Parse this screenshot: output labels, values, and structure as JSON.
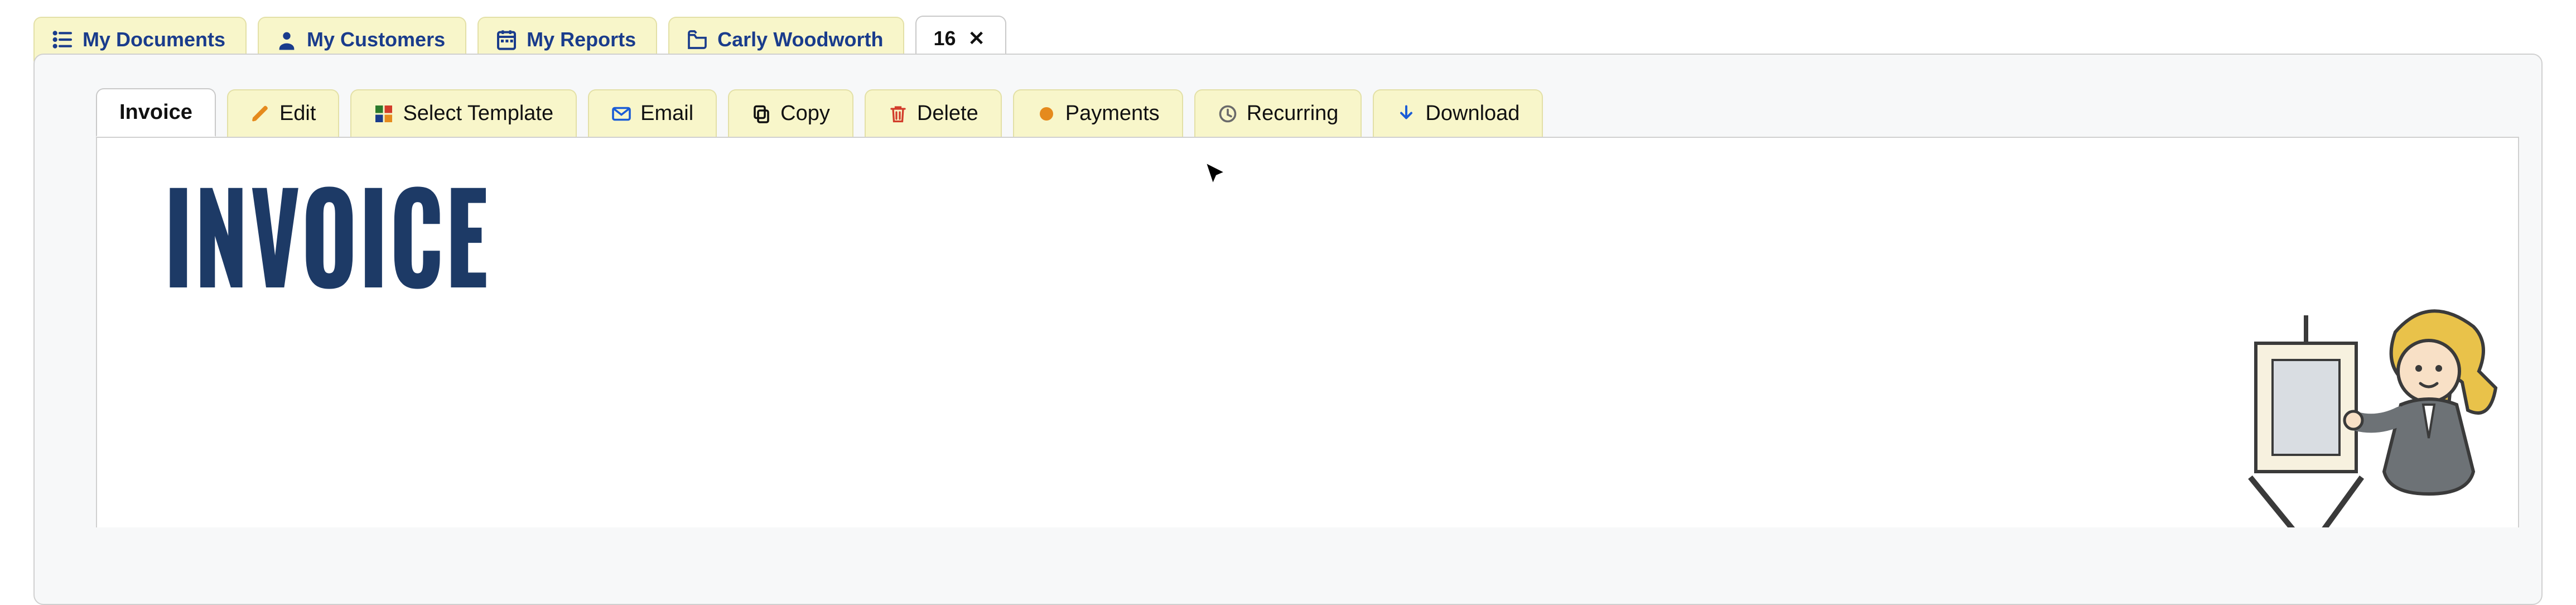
{
  "top_tabs": [
    {
      "label": "My Documents",
      "icon": "list"
    },
    {
      "label": "My Customers",
      "icon": "user"
    },
    {
      "label": "My Reports",
      "icon": "calendar"
    },
    {
      "label": "Carly Woodworth",
      "icon": "folder"
    },
    {
      "label": "16",
      "icon": "",
      "active": true,
      "closable": true
    }
  ],
  "sub_tabs": [
    {
      "label": "Invoice",
      "icon": "",
      "active": true
    },
    {
      "label": "Edit",
      "icon": "pencil"
    },
    {
      "label": "Select Template",
      "icon": "grid4"
    },
    {
      "label": "Email",
      "icon": "envelope"
    },
    {
      "label": "Copy",
      "icon": "copy"
    },
    {
      "label": "Delete",
      "icon": "trash"
    },
    {
      "label": "Payments",
      "icon": "dot-orange"
    },
    {
      "label": "Recurring",
      "icon": "clock"
    },
    {
      "label": "Download",
      "icon": "download"
    }
  ],
  "doc": {
    "title": "INVOICE"
  },
  "close_glyph": "✕"
}
